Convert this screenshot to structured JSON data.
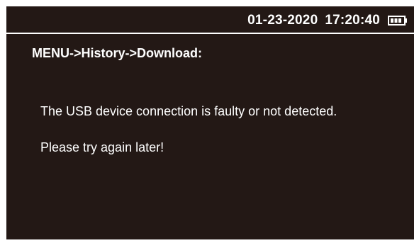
{
  "status_bar": {
    "date": "01-23-2020",
    "time": "17:20:40",
    "battery_icon": "battery-icon"
  },
  "breadcrumb": "MENU->History->Download:",
  "messages": [
    "The USB device connection is faulty or not detected.",
    "Please try again later!"
  ],
  "colors": {
    "screen_background": "#231815",
    "text": "#ffffff"
  }
}
